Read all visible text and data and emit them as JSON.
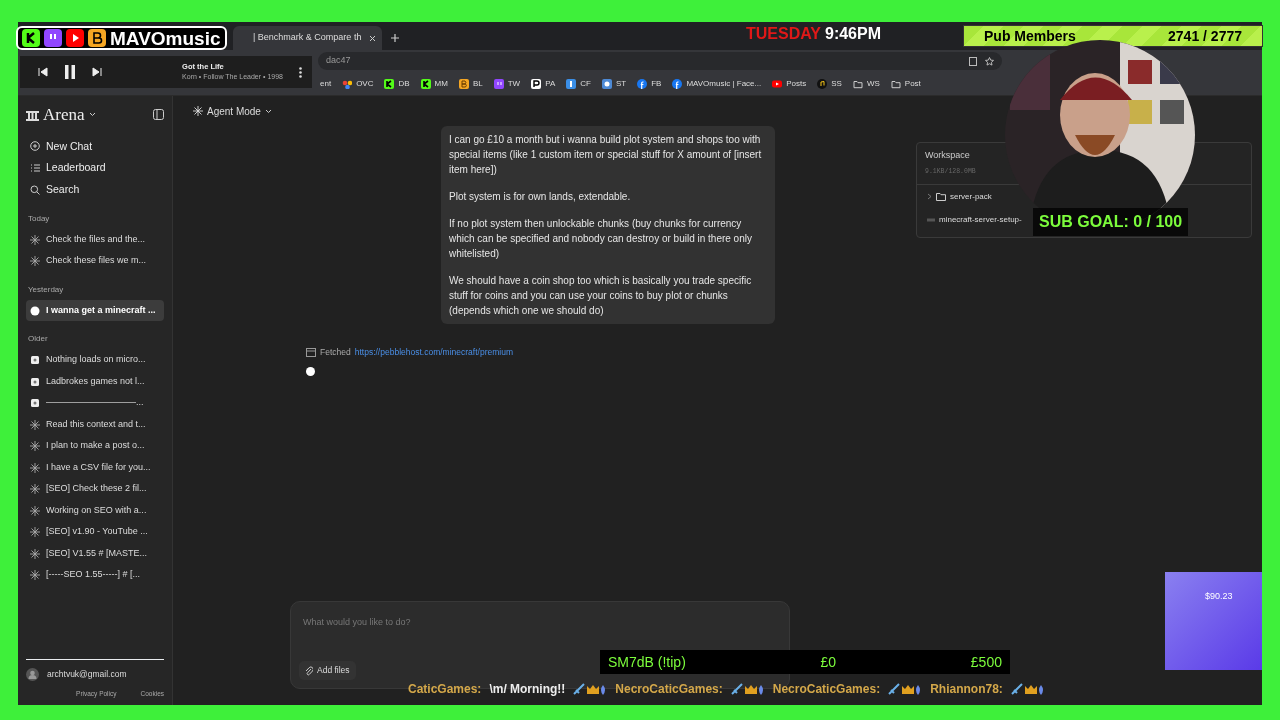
{
  "overlay": {
    "brand": "MAVOmusic",
    "brand_icons": [
      {
        "kind": "k",
        "color": "#53fc18"
      },
      {
        "kind": "twitch",
        "color": "#9146ff"
      },
      {
        "kind": "youtube",
        "color": "#ff0000"
      },
      {
        "kind": "b",
        "color": "#f5a623"
      }
    ],
    "media_player": {
      "title": "Got the Life",
      "subtitle": "Korn • Follow The Leader • 1998",
      "playing": true
    },
    "clock": {
      "day": "TUESDAY",
      "time": "9:46PM"
    },
    "pub_members": {
      "label": "Pub Members",
      "count": "2741 / 2777"
    },
    "sub_goal": "SUB GOAL: 0 / 100",
    "tip_bar": {
      "label": "SM7dB (!tip)",
      "current": "£0",
      "goal": "£500"
    },
    "ticker": [
      {
        "user": "CaticGames:",
        "message": "\\m/ Morning!!"
      },
      {
        "user": "NecroCaticGames:"
      },
      {
        "user": "NecroCaticGames:"
      },
      {
        "user": "Rhiannon78:"
      }
    ],
    "widget": {
      "amount": "$90.23"
    }
  },
  "browser": {
    "tab": {
      "title": "| Benchmark & Compare th"
    },
    "address": "dac47",
    "bookmarks": [
      {
        "label": "ent",
        "kind": "none"
      },
      {
        "label": "OVC",
        "kind": "dots"
      },
      {
        "label": "DB",
        "kind": "k"
      },
      {
        "label": "MM",
        "kind": "k"
      },
      {
        "label": "BL",
        "kind": "b"
      },
      {
        "label": "TW",
        "kind": "twitch"
      },
      {
        "label": "PA",
        "kind": "p"
      },
      {
        "label": "CF",
        "kind": "cf"
      },
      {
        "label": "ST",
        "kind": "st"
      },
      {
        "label": "FB",
        "kind": "fb"
      },
      {
        "label": "MAVOmusic | Face...",
        "kind": "fb"
      },
      {
        "label": "Posts",
        "kind": "youtube"
      },
      {
        "label": "SS",
        "kind": "music"
      },
      {
        "label": "WS",
        "kind": "folder"
      },
      {
        "label": "Post",
        "kind": "folder"
      }
    ]
  },
  "sidebar": {
    "brand": "Arena",
    "nav": [
      {
        "label": "New Chat",
        "kind": "plus"
      },
      {
        "label": "Leaderboard",
        "kind": "list"
      },
      {
        "label": "Search",
        "kind": "search"
      }
    ],
    "sections": [
      {
        "title": "Today",
        "items": [
          {
            "label": "Check the files and the...",
            "kind": "sparkle",
            "selected": false
          },
          {
            "label": "Check these files we m...",
            "kind": "sparkle",
            "selected": false
          }
        ]
      },
      {
        "title": "Yesterday",
        "items": [
          {
            "label": "I wanna get a minecraft ...",
            "kind": "dot",
            "selected": true
          }
        ]
      },
      {
        "title": "Older",
        "items": [
          {
            "label": "Nothing loads on micro...",
            "kind": "square",
            "selected": false
          },
          {
            "label": "Ladbrokes games not l...",
            "kind": "square",
            "selected": false
          },
          {
            "label": "——————————...",
            "kind": "square",
            "selected": false
          },
          {
            "label": "Read this context and t...",
            "kind": "sparkle",
            "selected": false
          },
          {
            "label": "I plan to make a post o...",
            "kind": "sparkle",
            "selected": false
          },
          {
            "label": "I have a CSV file for you...",
            "kind": "sparkle",
            "selected": false
          },
          {
            "label": "[SEO] Check these 2 fil...",
            "kind": "sparkle",
            "selected": false
          },
          {
            "label": "Working on SEO with a...",
            "kind": "sparkle",
            "selected": false
          },
          {
            "label": "[SEO] v1.90 - YouTube ...",
            "kind": "sparkle",
            "selected": false
          },
          {
            "label": "[SEO] V1.55 # [MASTE...",
            "kind": "sparkle",
            "selected": false
          },
          {
            "label": "[-----SEO 1.55-----] # [...",
            "kind": "sparkle",
            "selected": false
          }
        ]
      }
    ],
    "user": "archtvuk@gmail.com",
    "footer_links": [
      "Privacy Policy",
      "Cookies"
    ]
  },
  "header": {
    "mode": "Agent Mode"
  },
  "message": [
    "I can go £10 a month but i wanna build plot system and shops too with special items (like 1 custom item or special stuff for X amount of [insert item here])",
    "Plot system is for own lands, extendable.",
    "If no plot system then unlockable chunks (buy chunks for currency which can be specified and nobody can destroy or build in there only whitelisted)",
    "We should have a coin shop too which is basically you trade specific stuff for coins and you can use your coins to buy plot or chunks (depends which one we should do)"
  ],
  "fetched": {
    "label": "Fetched",
    "url": "https://pebblehost.com/minecraft/premium"
  },
  "composer": {
    "placeholder": "What would you like to do?",
    "attach": "Add files"
  },
  "workspace": {
    "title": "Workspace",
    "usage": "9.1KB/128.0MB",
    "items": [
      {
        "label": "server-pack",
        "kind": "folder"
      },
      {
        "label": "minecraft-server-setup-",
        "kind": "file"
      }
    ]
  }
}
